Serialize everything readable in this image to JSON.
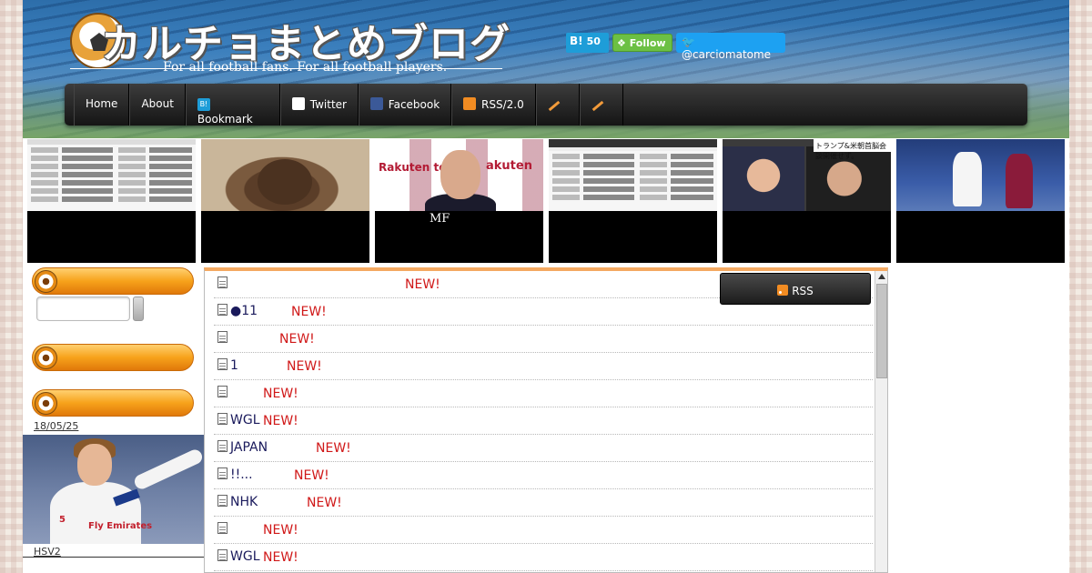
{
  "header": {
    "site_title": "カルチョまとめブログ",
    "subtitle": "For all football fans.  For all football players.",
    "hatena_label": "B!",
    "hatena_count": "50",
    "follow_label": "Follow",
    "twitter_handle": "@carciomatome"
  },
  "nav": {
    "items": [
      {
        "label": "Home"
      },
      {
        "label": "About"
      },
      {
        "label": "Bookmark"
      },
      {
        "label": "Twitter"
      },
      {
        "label": "Facebook"
      },
      {
        "label": "RSS/2.0"
      }
    ]
  },
  "thumbnails": [
    {
      "caption": ""
    },
    {
      "caption": ""
    },
    {
      "caption": "MF"
    },
    {
      "caption": ""
    },
    {
      "caption": ""
    },
    {
      "caption": ""
    }
  ],
  "thumb_texts": {
    "rakuten_left": "Rakuten toto",
    "rakuten_right": "akuten",
    "news_title": "トランプ&#38;米朝首脳会談開催せず。"
  },
  "sidebar": {
    "date": "18/05/25",
    "photo_logo": "Fly Emirates",
    "photo_num": "5",
    "caption": "HSV2"
  },
  "feed": {
    "rss_label": "RSS",
    "rows": [
      {
        "text": "",
        "new": "NEW!"
      },
      {
        "text": "●11",
        "new": "NEW!"
      },
      {
        "text": "",
        "new": "NEW!"
      },
      {
        "text": "1",
        "new": "NEW!"
      },
      {
        "text": "",
        "new": "NEW!"
      },
      {
        "text": "WGL",
        "new": "NEW!"
      },
      {
        "text": "JAPAN",
        "new": "NEW!"
      },
      {
        "text": "!!...",
        "new": "NEW!"
      },
      {
        "text": "NHK",
        "new": "NEW!"
      },
      {
        "text": "",
        "new": "NEW!"
      },
      {
        "text": "WGL",
        "new": "NEW!"
      }
    ]
  },
  "colors": {
    "accent_orange": "#f7a21b",
    "new_red": "#d01818",
    "nav_dark": "#151515",
    "hatena_blue": "#1e9dd8",
    "follow_green": "#6cc044",
    "twitter_blue": "#1da1f2"
  }
}
